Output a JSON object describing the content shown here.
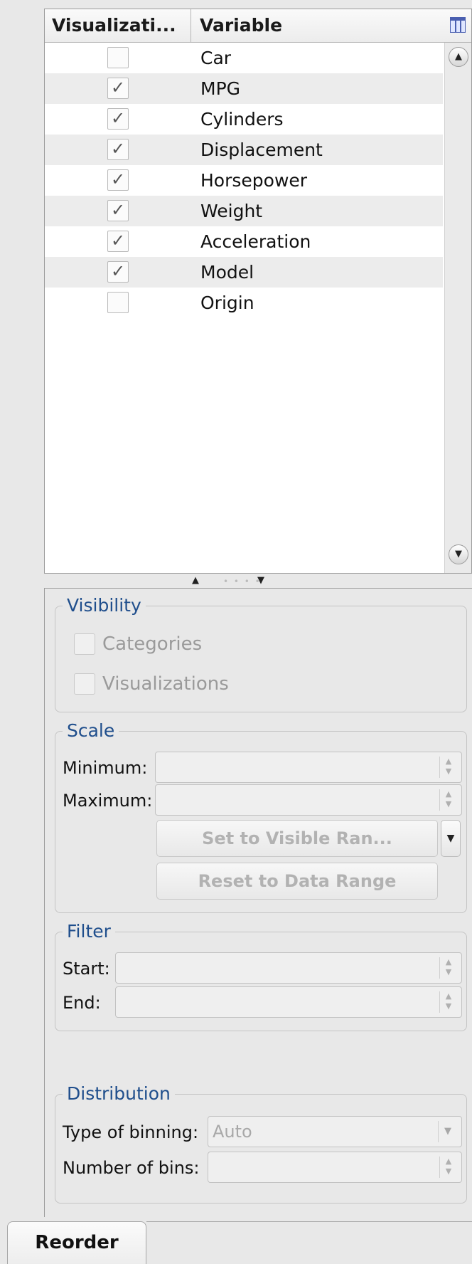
{
  "table": {
    "columns": [
      "Visualizati...",
      "Variable"
    ],
    "rows": [
      {
        "variable": "Car",
        "checked": false
      },
      {
        "variable": "MPG",
        "checked": true
      },
      {
        "variable": "Cylinders",
        "checked": true
      },
      {
        "variable": "Displacement",
        "checked": true
      },
      {
        "variable": "Horsepower",
        "checked": true
      },
      {
        "variable": "Weight",
        "checked": true
      },
      {
        "variable": "Acceleration",
        "checked": true
      },
      {
        "variable": "Model",
        "checked": true
      },
      {
        "variable": "Origin",
        "checked": false
      }
    ],
    "column_chooser_icon": "column-chooser-icon",
    "check_glyph": "✓"
  },
  "visibility": {
    "title": "Visibility",
    "categories_label": "Categories",
    "visualizations_label": "Visualizations"
  },
  "scale": {
    "title": "Scale",
    "minimum_label": "Minimum:",
    "maximum_label": "Maximum:",
    "set_visible_label": "Set to Visible Ran...",
    "reset_label": "Reset to Data Range"
  },
  "filter": {
    "title": "Filter",
    "start_label": "Start:",
    "end_label": "End:"
  },
  "distribution": {
    "title": "Distribution",
    "binning_label": "Type of binning:",
    "binning_value": "Auto",
    "bins_label": "Number of bins:"
  },
  "tabs": {
    "reorder_label": "Reorder"
  },
  "colors": {
    "group_title": "#1f4e8c",
    "disabled_text": "#9a9a9a"
  }
}
